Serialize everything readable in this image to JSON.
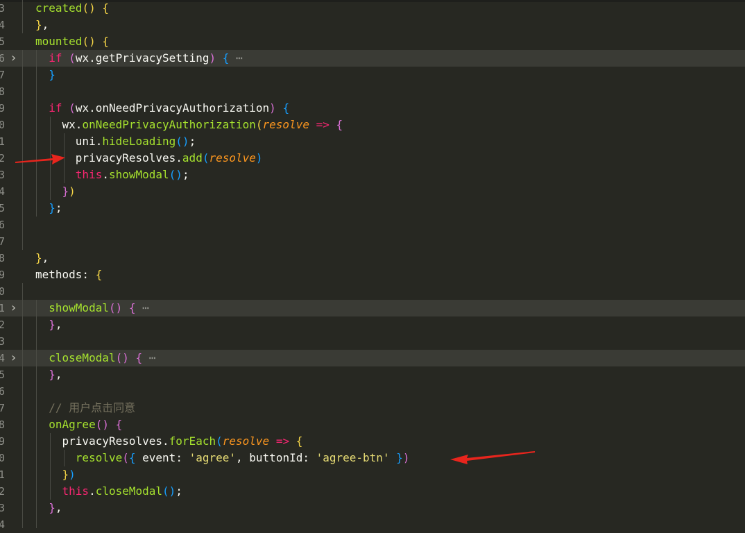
{
  "gutter": [
    "3",
    "4",
    "5",
    "6",
    "7",
    "8",
    "9",
    "0",
    "1",
    "2",
    "3",
    "4",
    "5",
    "6",
    "7",
    "8",
    "9",
    "0",
    "1",
    "2",
    "3",
    "4",
    "5",
    "6",
    "7",
    "8",
    "9",
    "0",
    "1",
    "2",
    "3",
    "4"
  ],
  "lines": [
    {
      "num": "3",
      "tokens": [
        [
          "f",
          "created"
        ],
        [
          "br1",
          "()"
        ],
        [
          "t",
          " "
        ],
        [
          "br1",
          "{"
        ]
      ]
    },
    {
      "num": "4",
      "tokens": [
        [
          "br1",
          "}"
        ],
        [
          "t",
          ","
        ]
      ]
    },
    {
      "num": "5",
      "tokens": [
        [
          "f",
          "mounted"
        ],
        [
          "br1",
          "()"
        ],
        [
          "t",
          " "
        ],
        [
          "br1",
          "{"
        ]
      ]
    },
    {
      "num": "6",
      "fold": true,
      "tokens": [
        [
          "t",
          "  "
        ],
        [
          "k",
          "if"
        ],
        [
          "t",
          " "
        ],
        [
          "br2",
          "("
        ],
        [
          "t",
          "wx.getPrivacySetting"
        ],
        [
          "br2",
          ")"
        ],
        [
          "t",
          " "
        ],
        [
          "br3",
          "{"
        ],
        [
          "dots",
          " ⋯"
        ]
      ]
    },
    {
      "num": "7",
      "tokens": [
        [
          "t",
          "  "
        ],
        [
          "br3",
          "}"
        ]
      ]
    },
    {
      "num": "8",
      "tokens": []
    },
    {
      "num": "9",
      "tokens": [
        [
          "t",
          "  "
        ],
        [
          "k",
          "if"
        ],
        [
          "t",
          " "
        ],
        [
          "br2",
          "("
        ],
        [
          "t",
          "wx.onNeedPrivacyAuthorization"
        ],
        [
          "br2",
          ")"
        ],
        [
          "t",
          " "
        ],
        [
          "br3",
          "{"
        ]
      ]
    },
    {
      "num": "0",
      "tokens": [
        [
          "t",
          "    wx."
        ],
        [
          "f",
          "onNeedPrivacyAuthorization"
        ],
        [
          "br1",
          "("
        ],
        [
          "p",
          "resolve"
        ],
        [
          "t",
          " "
        ],
        [
          "k",
          "=>"
        ],
        [
          "t",
          " "
        ],
        [
          "br2",
          "{"
        ]
      ]
    },
    {
      "num": "1",
      "tokens": [
        [
          "t",
          "      uni."
        ],
        [
          "f",
          "hideLoading"
        ],
        [
          "br3",
          "()"
        ],
        [
          "t",
          ";"
        ]
      ]
    },
    {
      "num": "2",
      "tokens": [
        [
          "t",
          "      privacyResolves."
        ],
        [
          "f",
          "add"
        ],
        [
          "br3",
          "("
        ],
        [
          "p",
          "resolve"
        ],
        [
          "br3",
          ")"
        ]
      ]
    },
    {
      "num": "3",
      "tokens": [
        [
          "t",
          "      "
        ],
        [
          "k",
          "this"
        ],
        [
          "t",
          "."
        ],
        [
          "f",
          "showModal"
        ],
        [
          "br3",
          "()"
        ],
        [
          "t",
          ";"
        ]
      ]
    },
    {
      "num": "4",
      "tokens": [
        [
          "t",
          "    "
        ],
        [
          "br2",
          "}"
        ],
        [
          "br1",
          ")"
        ]
      ]
    },
    {
      "num": "5",
      "tokens": [
        [
          "t",
          "  "
        ],
        [
          "br3",
          "}"
        ],
        [
          "t",
          ";"
        ]
      ]
    },
    {
      "num": "6",
      "tokens": []
    },
    {
      "num": "7",
      "tokens": []
    },
    {
      "num": "8",
      "tokens": [
        [
          "br1",
          "}"
        ],
        [
          "t",
          ","
        ]
      ]
    },
    {
      "num": "9",
      "tokens": [
        [
          "t",
          "methods: "
        ],
        [
          "br1",
          "{"
        ]
      ]
    },
    {
      "num": "0",
      "tokens": []
    },
    {
      "num": "1",
      "fold": true,
      "tokens": [
        [
          "t",
          "  "
        ],
        [
          "f",
          "showModal"
        ],
        [
          "br2",
          "()"
        ],
        [
          "t",
          " "
        ],
        [
          "br2",
          "{"
        ],
        [
          "dots",
          " ⋯"
        ]
      ]
    },
    {
      "num": "2",
      "tokens": [
        [
          "t",
          "  "
        ],
        [
          "br2",
          "}"
        ],
        [
          "t",
          ","
        ]
      ]
    },
    {
      "num": "3",
      "tokens": []
    },
    {
      "num": "4",
      "fold": true,
      "tokens": [
        [
          "t",
          "  "
        ],
        [
          "f",
          "closeModal"
        ],
        [
          "br2",
          "()"
        ],
        [
          "t",
          " "
        ],
        [
          "br2",
          "{"
        ],
        [
          "dots",
          " ⋯"
        ]
      ]
    },
    {
      "num": "5",
      "tokens": [
        [
          "t",
          "  "
        ],
        [
          "br2",
          "}"
        ],
        [
          "t",
          ","
        ]
      ]
    },
    {
      "num": "6",
      "tokens": []
    },
    {
      "num": "7",
      "tokens": [
        [
          "t",
          "  "
        ],
        [
          "c",
          "// 用户点击同意"
        ]
      ]
    },
    {
      "num": "8",
      "tokens": [
        [
          "t",
          "  "
        ],
        [
          "f",
          "onAgree"
        ],
        [
          "br2",
          "()"
        ],
        [
          "t",
          " "
        ],
        [
          "br2",
          "{"
        ]
      ]
    },
    {
      "num": "9",
      "tokens": [
        [
          "t",
          "    privacyResolves."
        ],
        [
          "f",
          "forEach"
        ],
        [
          "br3",
          "("
        ],
        [
          "p",
          "resolve"
        ],
        [
          "t",
          " "
        ],
        [
          "k",
          "=>"
        ],
        [
          "t",
          " "
        ],
        [
          "br1",
          "{"
        ]
      ]
    },
    {
      "num": "0",
      "tokens": [
        [
          "t",
          "      "
        ],
        [
          "f",
          "resolve"
        ],
        [
          "br2",
          "("
        ],
        [
          "br3",
          "{"
        ],
        [
          "t",
          " event: "
        ],
        [
          "s",
          "'agree'"
        ],
        [
          "t",
          ", buttonId: "
        ],
        [
          "s",
          "'agree-btn'"
        ],
        [
          "t",
          " "
        ],
        [
          "br3",
          "}"
        ],
        [
          "br2",
          ")"
        ]
      ]
    },
    {
      "num": "1",
      "tokens": [
        [
          "t",
          "    "
        ],
        [
          "br1",
          "}"
        ],
        [
          "br3",
          ")"
        ]
      ]
    },
    {
      "num": "2",
      "tokens": [
        [
          "t",
          "    "
        ],
        [
          "k",
          "this"
        ],
        [
          "t",
          "."
        ],
        [
          "f",
          "closeModal"
        ],
        [
          "br3",
          "()"
        ],
        [
          "t",
          ";"
        ]
      ]
    },
    {
      "num": "3",
      "tokens": [
        [
          "t",
          "  "
        ],
        [
          "br2",
          "}"
        ],
        [
          "t",
          ","
        ]
      ]
    },
    {
      "num": "4",
      "tokens": []
    }
  ],
  "annotations": [
    {
      "name": "arrow-annotation-privacy-resolves",
      "color": "#e8251d"
    },
    {
      "name": "arrow-annotation-agree-resolve",
      "color": "#e8251d"
    }
  ]
}
